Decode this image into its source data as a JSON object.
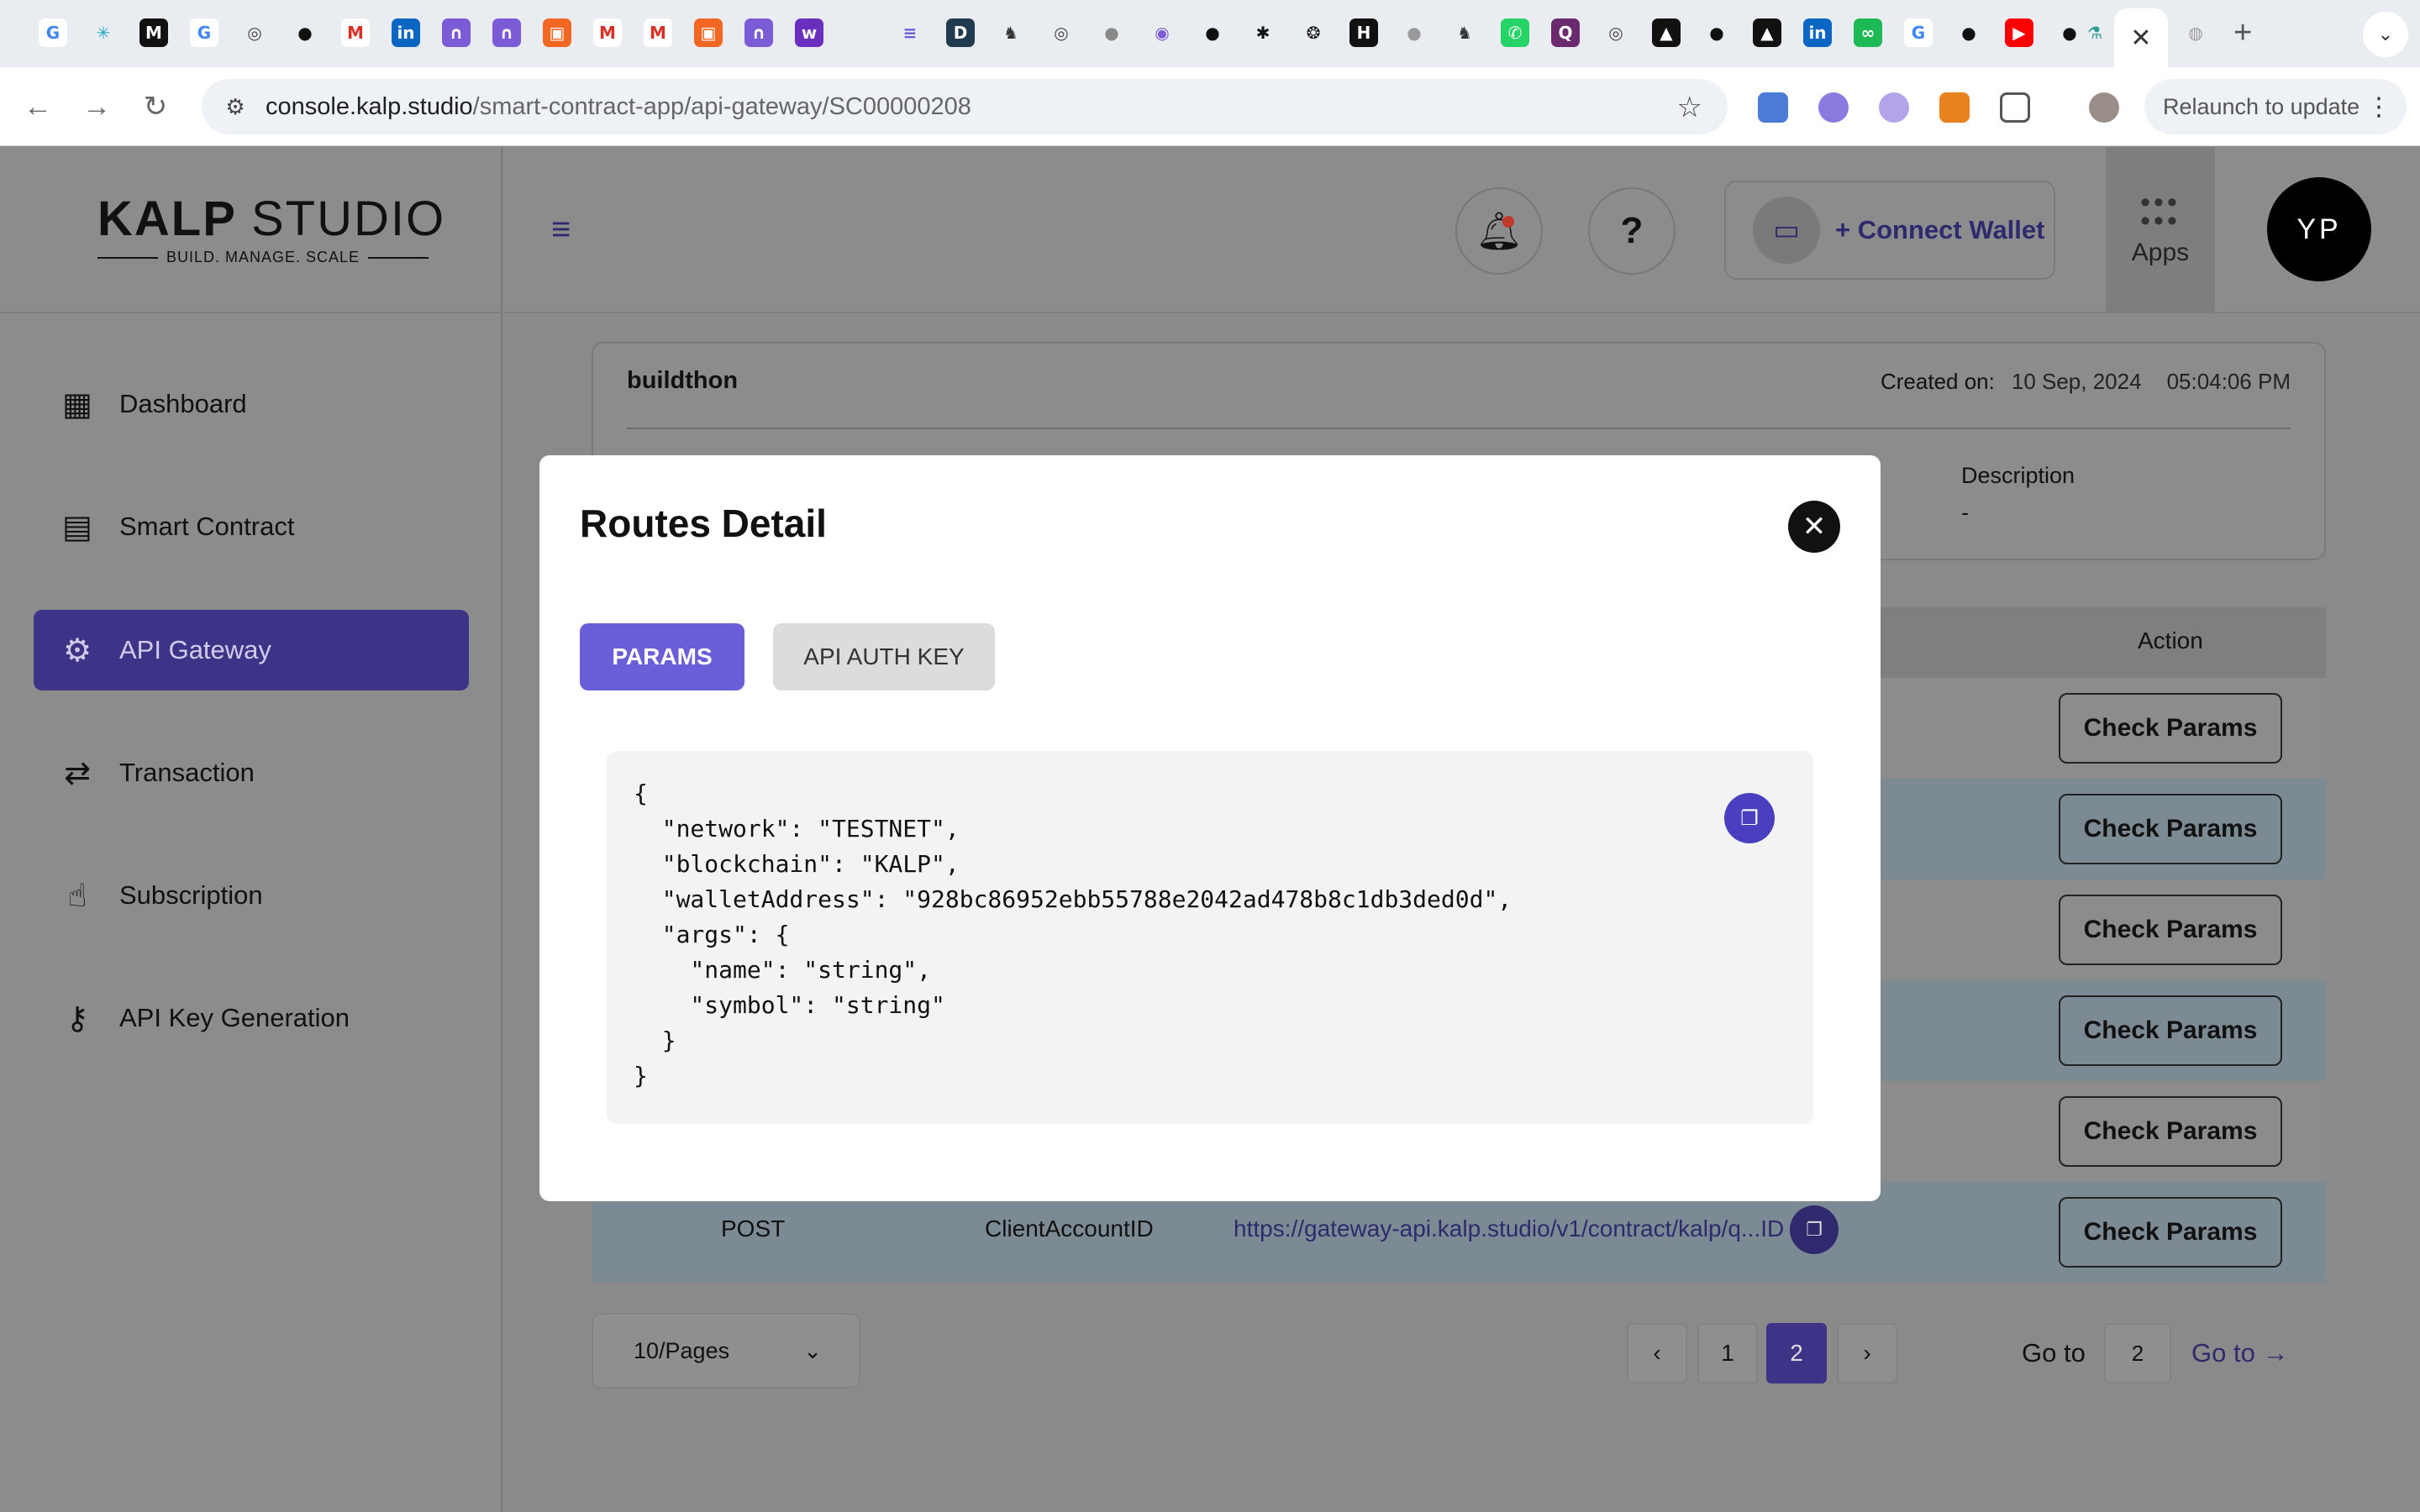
{
  "browser": {
    "url_host": "console.kalp.studio",
    "url_path": "/smart-contract-app/api-gateway/SC00000208",
    "relaunch_label": "Relaunch to update",
    "active_tab_close": "✕"
  },
  "brand": {
    "name_bold": "KALP",
    "name_thin": "STUDIO",
    "tagline": "BUILD. MANAGE. SCALE"
  },
  "sidebar": {
    "items": [
      {
        "label": "Dashboard",
        "icon": "grid-icon"
      },
      {
        "label": "Smart Contract",
        "icon": "document-icon"
      },
      {
        "label": "API Gateway",
        "icon": "chip-icon"
      },
      {
        "label": "Transaction",
        "icon": "arrows-icon"
      },
      {
        "label": "Subscription",
        "icon": "hand-icon"
      },
      {
        "label": "API Key Generation",
        "icon": "key-icon"
      }
    ]
  },
  "header": {
    "connect_wallet": "+ Connect Wallet",
    "apps_label": "Apps",
    "avatar_initials": "YP"
  },
  "card": {
    "title": "buildthon",
    "created_label": "Created on:",
    "created_date": "10 Sep, 2024",
    "created_time": "05:04:06 PM",
    "description_label": "Description",
    "description_value": "-"
  },
  "table": {
    "action_header": "Action",
    "check_params_label": "Check Params",
    "last_row": {
      "method": "POST",
      "name": "ClientAccountID",
      "url": "https://gateway-api.kalp.studio/v1/contract/kalp/q...ID"
    }
  },
  "pager": {
    "per_page": "10/Pages",
    "pages": [
      "1",
      "2"
    ],
    "current_page": "2",
    "goto_label": "Go to",
    "goto_value": "2",
    "goto_link": "Go to →"
  },
  "modal": {
    "title": "Routes Detail",
    "tab_params": "PARAMS",
    "tab_auth": "API AUTH KEY",
    "code_lines": [
      "{",
      "  \"network\": \"TESTNET\",",
      "  \"blockchain\": \"KALP\",",
      "  \"walletAddress\": \"928bc86952ebb55788e2042ad478b8c1db3ded0d\",",
      "  \"args\": {",
      "    \"name\": \"string\",",
      "    \"symbol\": \"string\"",
      "  }",
      "}"
    ]
  },
  "colors": {
    "accent": "#3d3488",
    "tab_active": "#6a5fd9"
  }
}
